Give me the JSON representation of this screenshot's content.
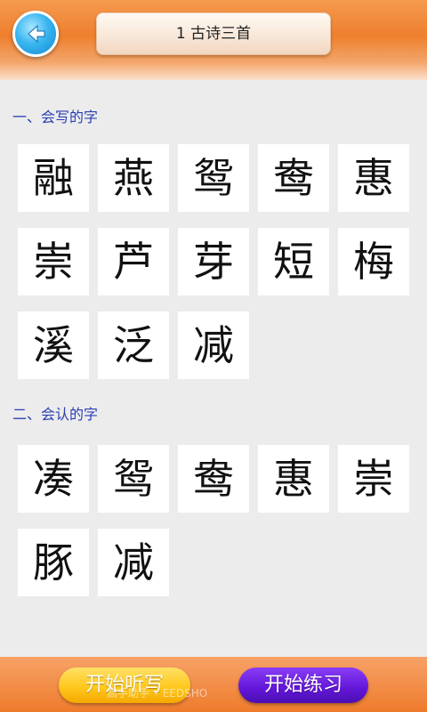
{
  "header": {
    "title": "1 古诗三首"
  },
  "section_write": {
    "title": "一、会写的字",
    "chars": [
      "融",
      "燕",
      "鸳",
      "鸯",
      "惠",
      "崇",
      "芦",
      "芽",
      "短",
      "梅",
      "溪",
      "泛",
      "减"
    ]
  },
  "section_read": {
    "title": "二、会认的字",
    "chars": [
      "凑",
      "鸳",
      "鸯",
      "惠",
      "崇",
      "豚",
      "减"
    ]
  },
  "footer": {
    "dictation_label": "开始听写",
    "practice_label": "开始练习",
    "watermark": "高手助手 • EEDSHO"
  },
  "colors": {
    "header_orange": "#ee7f2e",
    "section_blue": "#2a3fb3",
    "dictation_yellow": "#ffc81d",
    "practice_purple": "#6216d8"
  }
}
